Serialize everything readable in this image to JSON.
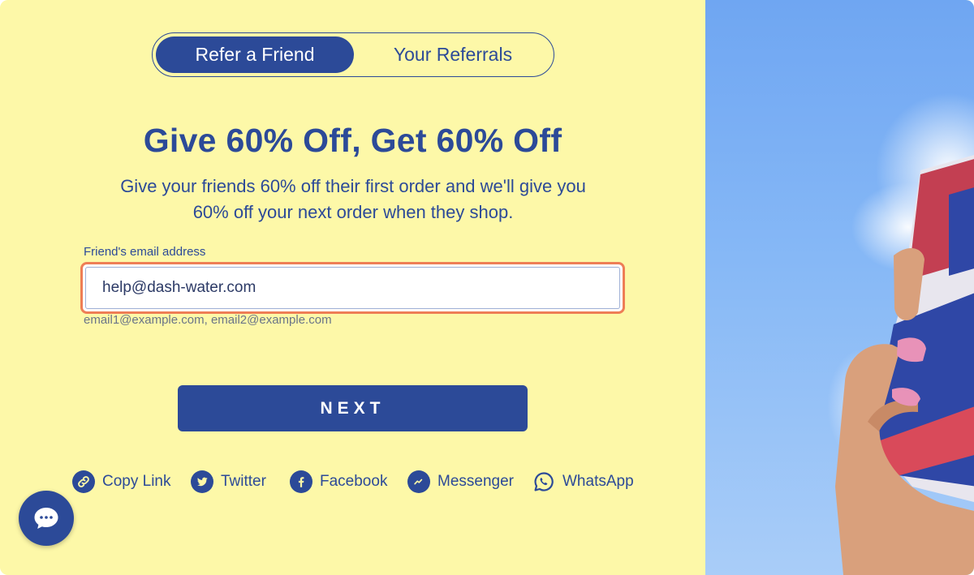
{
  "tabs": [
    {
      "label": "Refer a Friend",
      "active": true
    },
    {
      "label": "Your Referrals",
      "active": false
    }
  ],
  "headline": "Give 60% Off, Get 60% Off",
  "subtext_line1": "Give your friends 60% off their first order and we'll give you",
  "subtext_line2": "60% off your next order when they shop.",
  "email_field": {
    "label": "Friend's email address",
    "value": "help@dash-water.com",
    "hint": "email1@example.com, email2@example.com"
  },
  "next_button": "NEXT",
  "share": [
    {
      "label": "Copy Link",
      "icon": "link-icon"
    },
    {
      "label": "Twitter",
      "icon": "twitter-icon"
    },
    {
      "label": "Facebook",
      "icon": "facebook-icon"
    },
    {
      "label": "Messenger",
      "icon": "messenger-icon"
    },
    {
      "label": "WhatsApp",
      "icon": "whatsapp-icon"
    }
  ],
  "chat_icon": "chat-bubble-icon",
  "colors": {
    "panel_background": "#fdf8a8",
    "brand_navy": "#2c4a98",
    "focus_border": "#ee7e56",
    "sky_blue": "#86b8f6"
  }
}
